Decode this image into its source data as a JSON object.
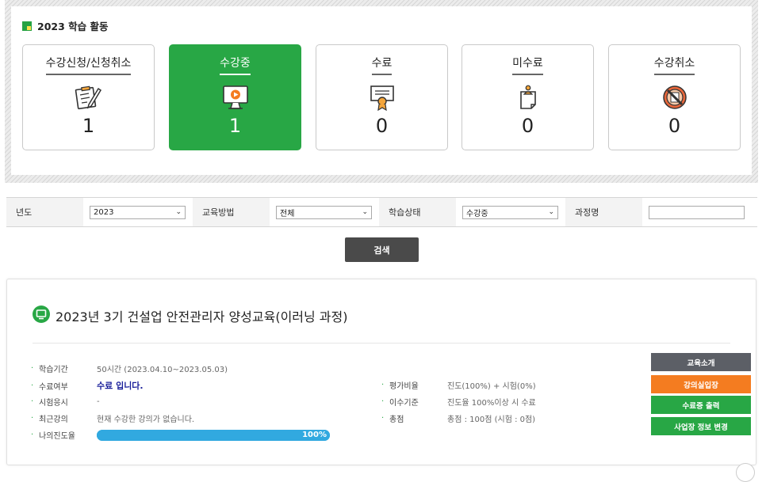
{
  "activity": {
    "title": "2023 학습 활동",
    "cards": [
      {
        "label": "수강신청/신청취소",
        "count": "1",
        "icon": "clipboard-pen-icon",
        "active": false
      },
      {
        "label": "수강중",
        "count": "1",
        "icon": "video-play-icon",
        "active": true
      },
      {
        "label": "수료",
        "count": "0",
        "icon": "certificate-icon",
        "active": false
      },
      {
        "label": "미수료",
        "count": "0",
        "icon": "document-person-icon",
        "active": false
      },
      {
        "label": "수강취소",
        "count": "0",
        "icon": "prohibited-icon",
        "active": false
      }
    ],
    "colors": {
      "active": "#28a745",
      "accent": "#26a243"
    }
  },
  "filters": {
    "year_label": "년도",
    "year_value": "2023",
    "method_label": "교육방법",
    "method_value": "전체",
    "status_label": "학습상태",
    "status_value": "수강중",
    "course_label": "과정명",
    "course_value": ""
  },
  "search_button": "검색",
  "course": {
    "title": "2023년 3기 건설업 안전관리자 양성교육(이러닝 과정)",
    "left": [
      {
        "label": "학습기간",
        "value": "50시간 (2023.04.10~2023.05.03)"
      },
      {
        "label": "수료여부",
        "value": "수료 입니다."
      },
      {
        "label": "시험응시",
        "value": "-"
      },
      {
        "label": "최근강의",
        "value": "현재 수강한 강의가 없습니다."
      },
      {
        "label": "나의진도율",
        "value": "100%"
      }
    ],
    "progress": 100,
    "right": [
      {
        "label": "평가비율",
        "value": "진도(100%) + 시험(0%)"
      },
      {
        "label": "이수기준",
        "value": "진도율 100%이상 시 수료"
      },
      {
        "label": "총점",
        "value": "총점 : 100점 (시험 : 0점)"
      }
    ],
    "buttons": [
      {
        "label": "교육소개",
        "color": "#5c5f66"
      },
      {
        "label": "강의실입장",
        "color": "#f47c20"
      },
      {
        "label": "수료증 출력",
        "color": "#28a745"
      },
      {
        "label": "사업장 정보 변경",
        "color": "#28a745"
      }
    ]
  }
}
